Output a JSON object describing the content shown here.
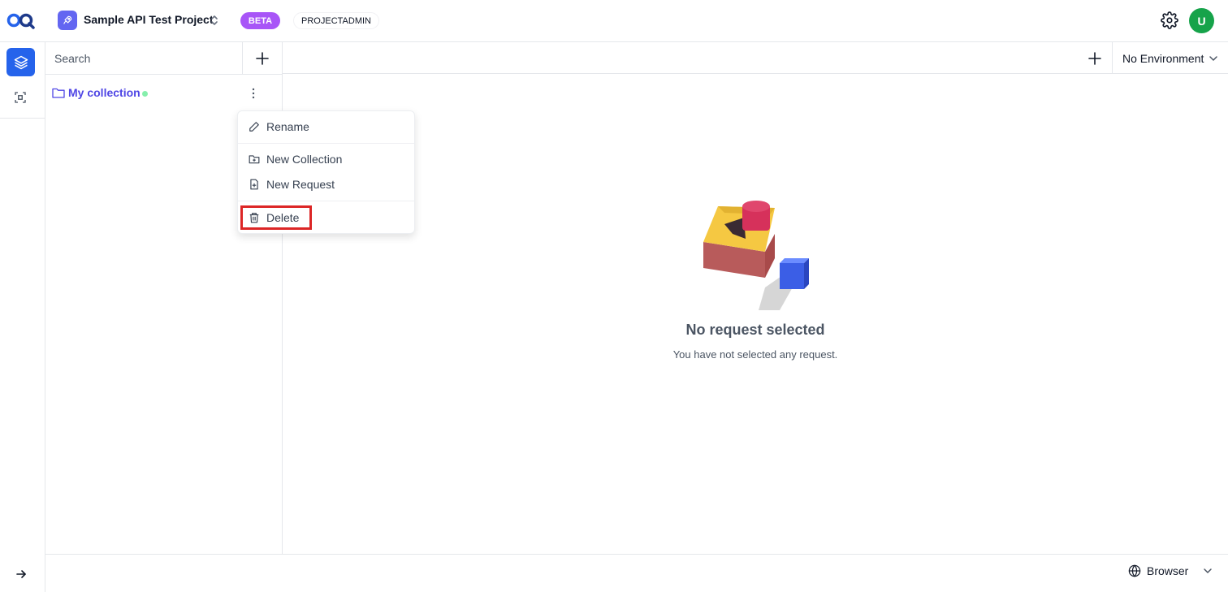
{
  "header": {
    "project_name": "Sample API Test Project",
    "beta_badge": "BETA",
    "role_badge": "PROJECTADMIN",
    "avatar_initial": "U",
    "icons": [
      "app-logo-icon",
      "rocket-icon",
      "chevron-updown-icon",
      "gear-icon"
    ]
  },
  "rail": {
    "items": [
      {
        "name": "collections",
        "icon": "layers-icon",
        "active": true
      },
      {
        "name": "environments",
        "icon": "frame-icon",
        "active": false
      }
    ],
    "expand_icon": "arrow-right-icon"
  },
  "sidebar": {
    "search_placeholder": "Search",
    "collection": {
      "name": "My collection",
      "status_color": "#86efac"
    }
  },
  "context_menu": {
    "items": [
      {
        "label": "Rename",
        "icon": "pencil-icon"
      },
      {
        "label": "New Collection",
        "icon": "folder-plus-icon"
      },
      {
        "label": "New Request",
        "icon": "file-plus-icon"
      },
      {
        "label": "Delete",
        "icon": "trash-icon",
        "highlighted": true
      }
    ]
  },
  "main": {
    "environment": "No Environment",
    "empty_title": "No request selected",
    "empty_subtitle": "You have not selected any request."
  },
  "footer": {
    "runtime": "Browser",
    "icon": "globe-icon"
  },
  "colors": {
    "accent": "#2563eb",
    "beta": "#a855f7",
    "collection_text": "#4f46e5",
    "avatar": "#16a34a",
    "highlight": "#dc2626"
  }
}
